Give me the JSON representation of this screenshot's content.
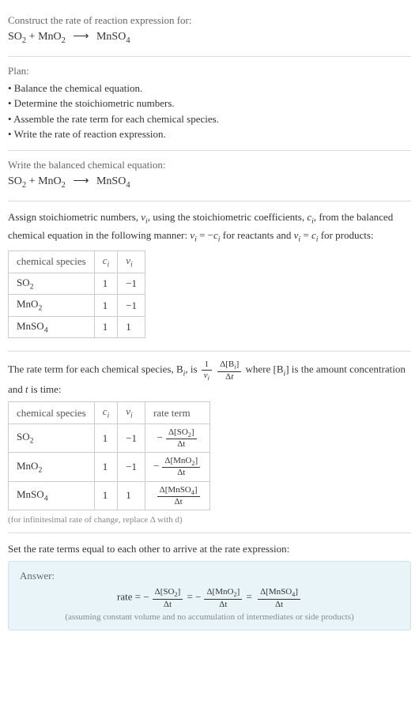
{
  "intro": {
    "construct": "Construct the rate of reaction expression for:",
    "equation_lhs1": "SO",
    "equation_lhs1_sub": "2",
    "equation_plus": " + ",
    "equation_lhs2": "MnO",
    "equation_lhs2_sub": "2",
    "arrow": "⟶",
    "equation_rhs": "MnSO",
    "equation_rhs_sub": "4"
  },
  "plan": {
    "header": "Plan:",
    "items": [
      "• Balance the chemical equation.",
      "• Determine the stoichiometric numbers.",
      "• Assemble the rate term for each chemical species.",
      "• Write the rate of reaction expression."
    ]
  },
  "balanced": {
    "header": "Write the balanced chemical equation:"
  },
  "stoich": {
    "explain_pre": "Assign stoichiometric numbers, ",
    "nu": "ν",
    "sub_i": "i",
    "explain_mid1": ", using the stoichiometric coefficients, ",
    "c": "c",
    "explain_mid2": ", from the balanced chemical equation in the following manner: ",
    "eq1_lhs": "ν",
    "eq1_eq": " = −",
    "eq1_rhs": "c",
    "explain_mid3": " for reactants and ",
    "eq2_eq": " = ",
    "explain_end": " for products:",
    "headers": {
      "species": "chemical species",
      "ci": "c",
      "vi": "ν"
    },
    "rows": [
      {
        "species": "SO",
        "sub": "2",
        "ci": "1",
        "vi": "−1"
      },
      {
        "species": "MnO",
        "sub": "2",
        "ci": "1",
        "vi": "−1"
      },
      {
        "species": "MnSO",
        "sub": "4",
        "ci": "1",
        "vi": "1"
      }
    ]
  },
  "rateterm": {
    "explain_pre": "The rate term for each chemical species, B",
    "explain_mid1": ", is ",
    "one": "1",
    "dB_num": "Δ[B",
    "dB_num_end": "]",
    "dt": "Δt",
    "explain_mid2": " where [B",
    "explain_mid3": "] is the amount concentration and ",
    "t": "t",
    "explain_end": " is time:",
    "headers": {
      "species": "chemical species",
      "ci": "c",
      "vi": "ν",
      "rate": "rate term"
    },
    "rows": [
      {
        "species": "SO",
        "sub": "2",
        "ci": "1",
        "vi": "−1",
        "neg": "−",
        "num": "Δ[SO",
        "numsub": "2",
        "numend": "]"
      },
      {
        "species": "MnO",
        "sub": "2",
        "ci": "1",
        "vi": "−1",
        "neg": "−",
        "num": "Δ[MnO",
        "numsub": "2",
        "numend": "]"
      },
      {
        "species": "MnSO",
        "sub": "4",
        "ci": "1",
        "vi": "1",
        "neg": "",
        "num": "Δ[MnSO",
        "numsub": "4",
        "numend": "]"
      }
    ],
    "note": "(for infinitesimal rate of change, replace Δ with d)"
  },
  "final": {
    "header": "Set the rate terms equal to each other to arrive at the rate expression:"
  },
  "answer": {
    "label": "Answer:",
    "rate": "rate = ",
    "neg": "−",
    "eq": " = ",
    "terms": [
      {
        "neg": "−",
        "num": "Δ[SO",
        "numsub": "2",
        "numend": "]"
      },
      {
        "neg": "−",
        "num": "Δ[MnO",
        "numsub": "2",
        "numend": "]"
      },
      {
        "neg": "",
        "num": "Δ[MnSO",
        "numsub": "4",
        "numend": "]"
      }
    ],
    "dt": "Δt",
    "note": "(assuming constant volume and no accumulation of intermediates or side products)"
  },
  "chart_data": {
    "type": "table",
    "tables": [
      {
        "title": "Stoichiometric numbers",
        "columns": [
          "chemical species",
          "c_i",
          "ν_i"
        ],
        "rows": [
          [
            "SO2",
            1,
            -1
          ],
          [
            "MnO2",
            1,
            -1
          ],
          [
            "MnSO4",
            1,
            1
          ]
        ]
      },
      {
        "title": "Rate terms",
        "columns": [
          "chemical species",
          "c_i",
          "ν_i",
          "rate term"
        ],
        "rows": [
          [
            "SO2",
            1,
            -1,
            "-Δ[SO2]/Δt"
          ],
          [
            "MnO2",
            1,
            -1,
            "-Δ[MnO2]/Δt"
          ],
          [
            "MnSO4",
            1,
            1,
            "Δ[MnSO4]/Δt"
          ]
        ]
      }
    ]
  }
}
